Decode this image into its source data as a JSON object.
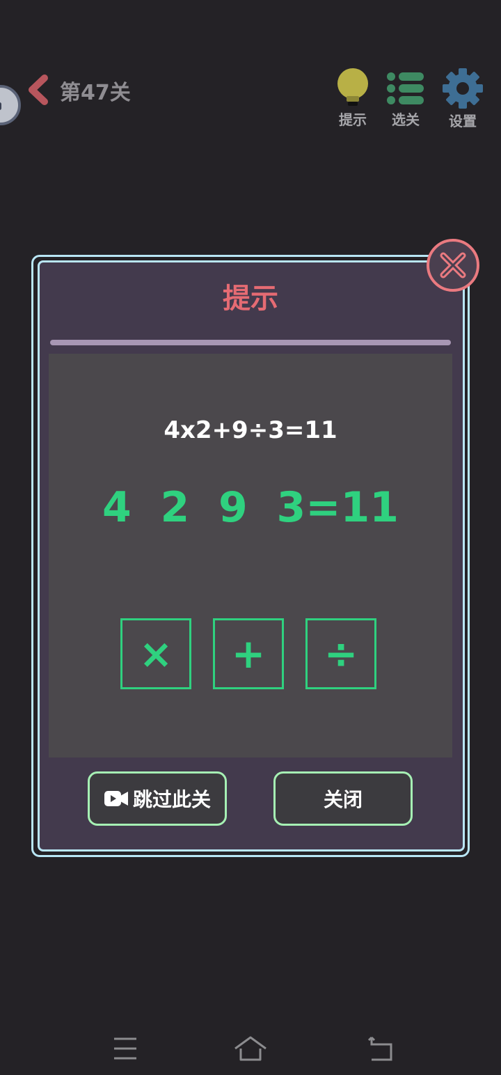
{
  "header": {
    "level_title": "第47关",
    "tools": [
      {
        "icon": "lightbulb-icon",
        "label": "提示"
      },
      {
        "icon": "list-icon",
        "label": "选关"
      },
      {
        "icon": "gear-icon",
        "label": "设置"
      }
    ]
  },
  "dialog": {
    "title": "提示",
    "solution": "4x2+9÷3=11",
    "puzzle": "4  2  9  3=11",
    "operators": [
      "×",
      "+",
      "÷"
    ],
    "skip_button": "跳过此关",
    "close_button": "关闭"
  },
  "colors": {
    "background": "#242226",
    "dialog_bg": "#433a4d",
    "accent_green": "#2fd17f",
    "title_red": "#e56b73",
    "border_blue": "#b9e6f5"
  }
}
